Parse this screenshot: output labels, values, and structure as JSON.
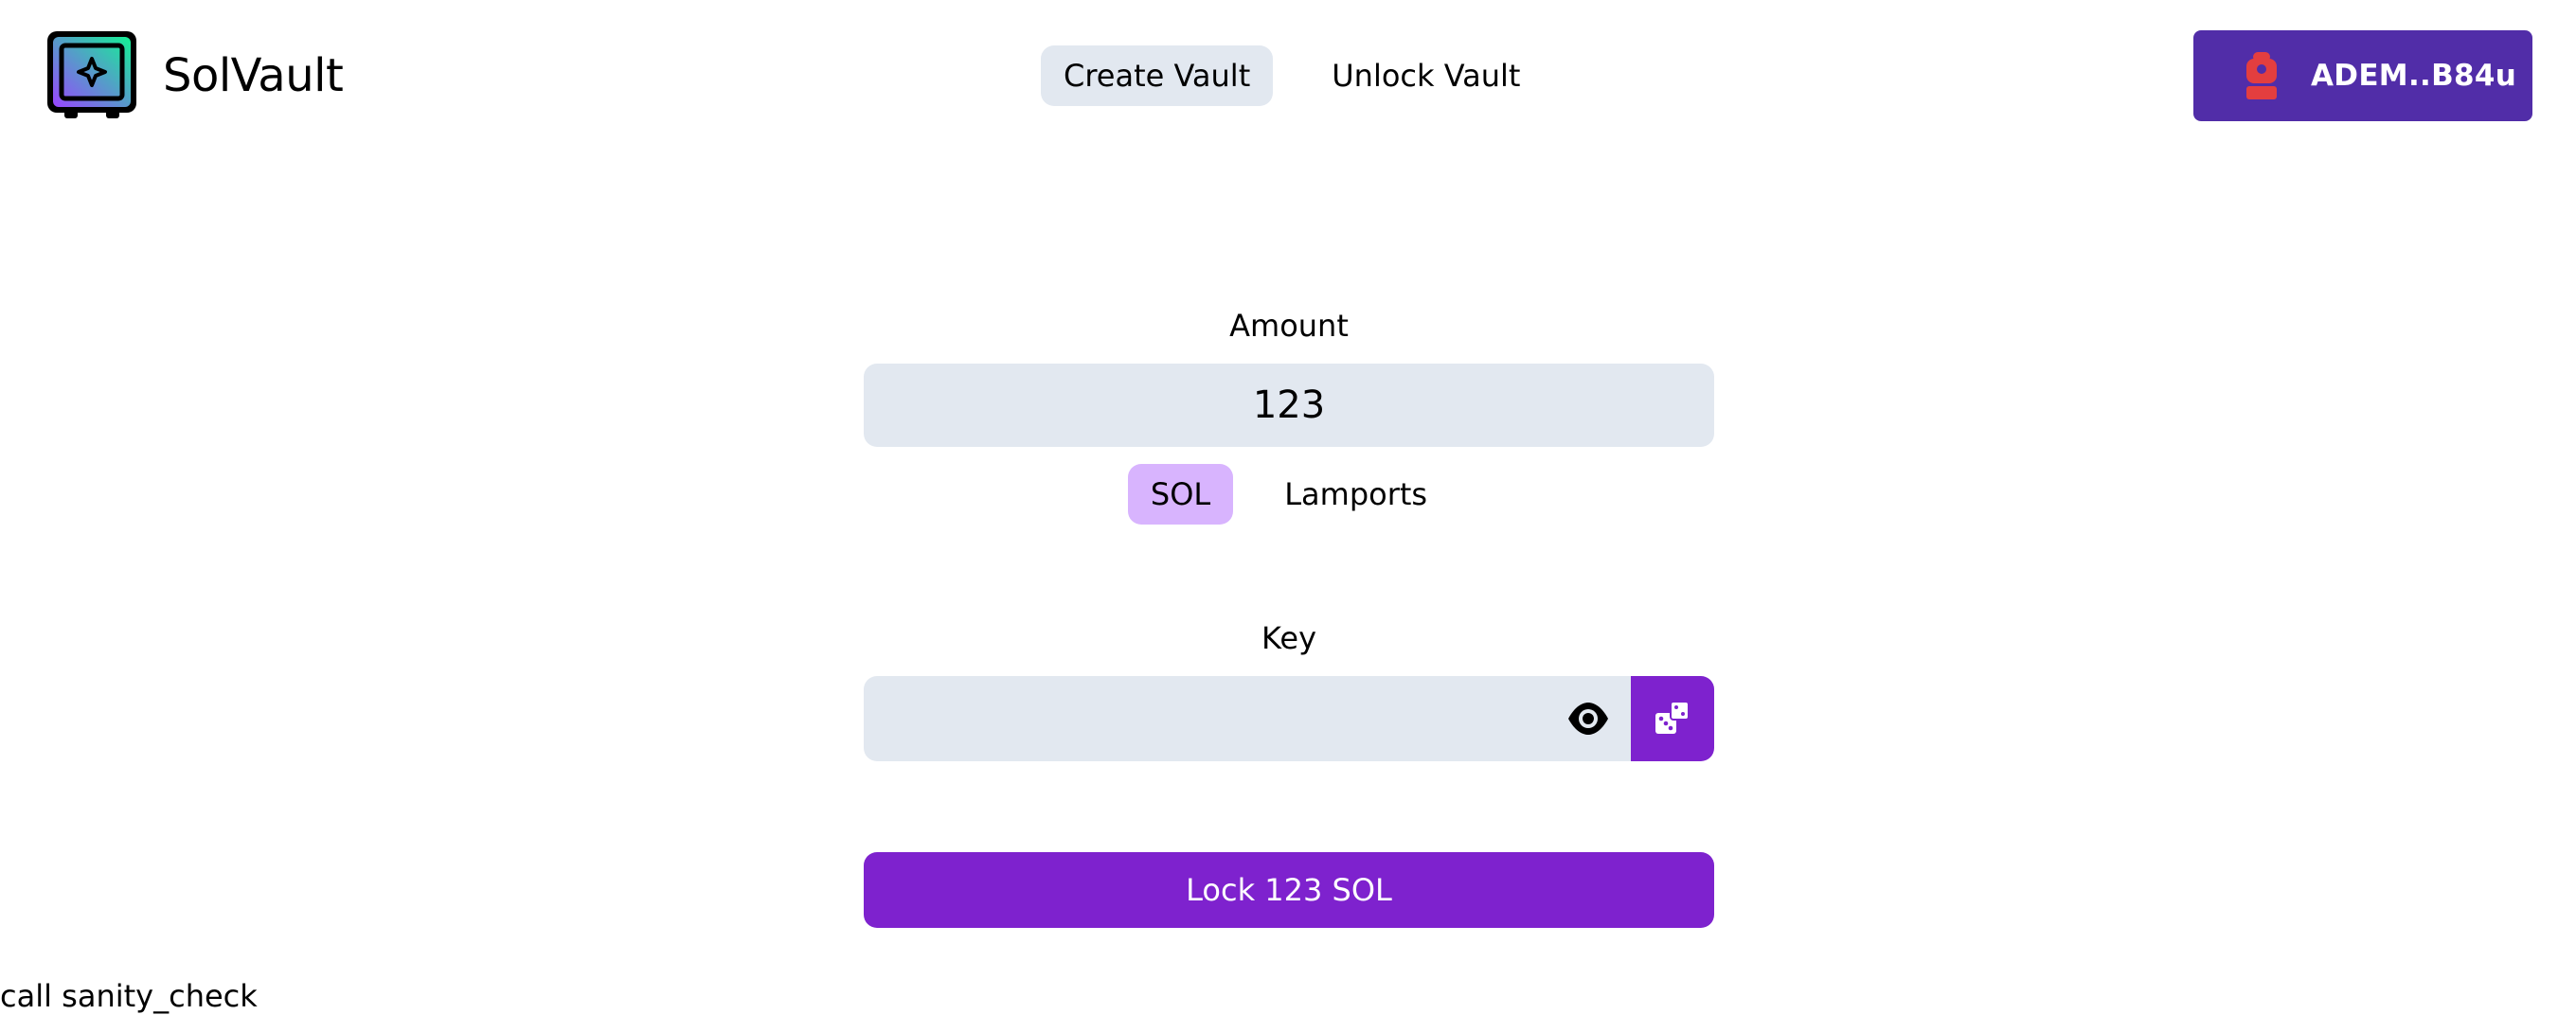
{
  "brand": {
    "name": "SolVault",
    "logo_icon": "vault-safe-icon"
  },
  "nav": {
    "tabs": [
      {
        "label": "Create Vault",
        "active": true
      },
      {
        "label": "Unlock Vault",
        "active": false
      }
    ]
  },
  "wallet": {
    "address": "ADEM..B84u",
    "icon": "wallet-backpack-icon"
  },
  "amount": {
    "label": "Amount",
    "value": "123",
    "units": [
      {
        "label": "SOL",
        "active": true
      },
      {
        "label": "Lamports",
        "active": false
      }
    ]
  },
  "key": {
    "label": "Key",
    "value": "",
    "reveal_icon": "eye-icon",
    "generate_icon": "dice-icon"
  },
  "action": {
    "lock_label": "Lock 123 SOL"
  },
  "log": {
    "text": "call sanity_check"
  },
  "colors": {
    "primary": "#7e22ce",
    "wallet": "#512da8",
    "input_bg": "#e2e8f0",
    "unit_active": "#d8b4fe",
    "wallet_icon": "#e33e3f"
  }
}
